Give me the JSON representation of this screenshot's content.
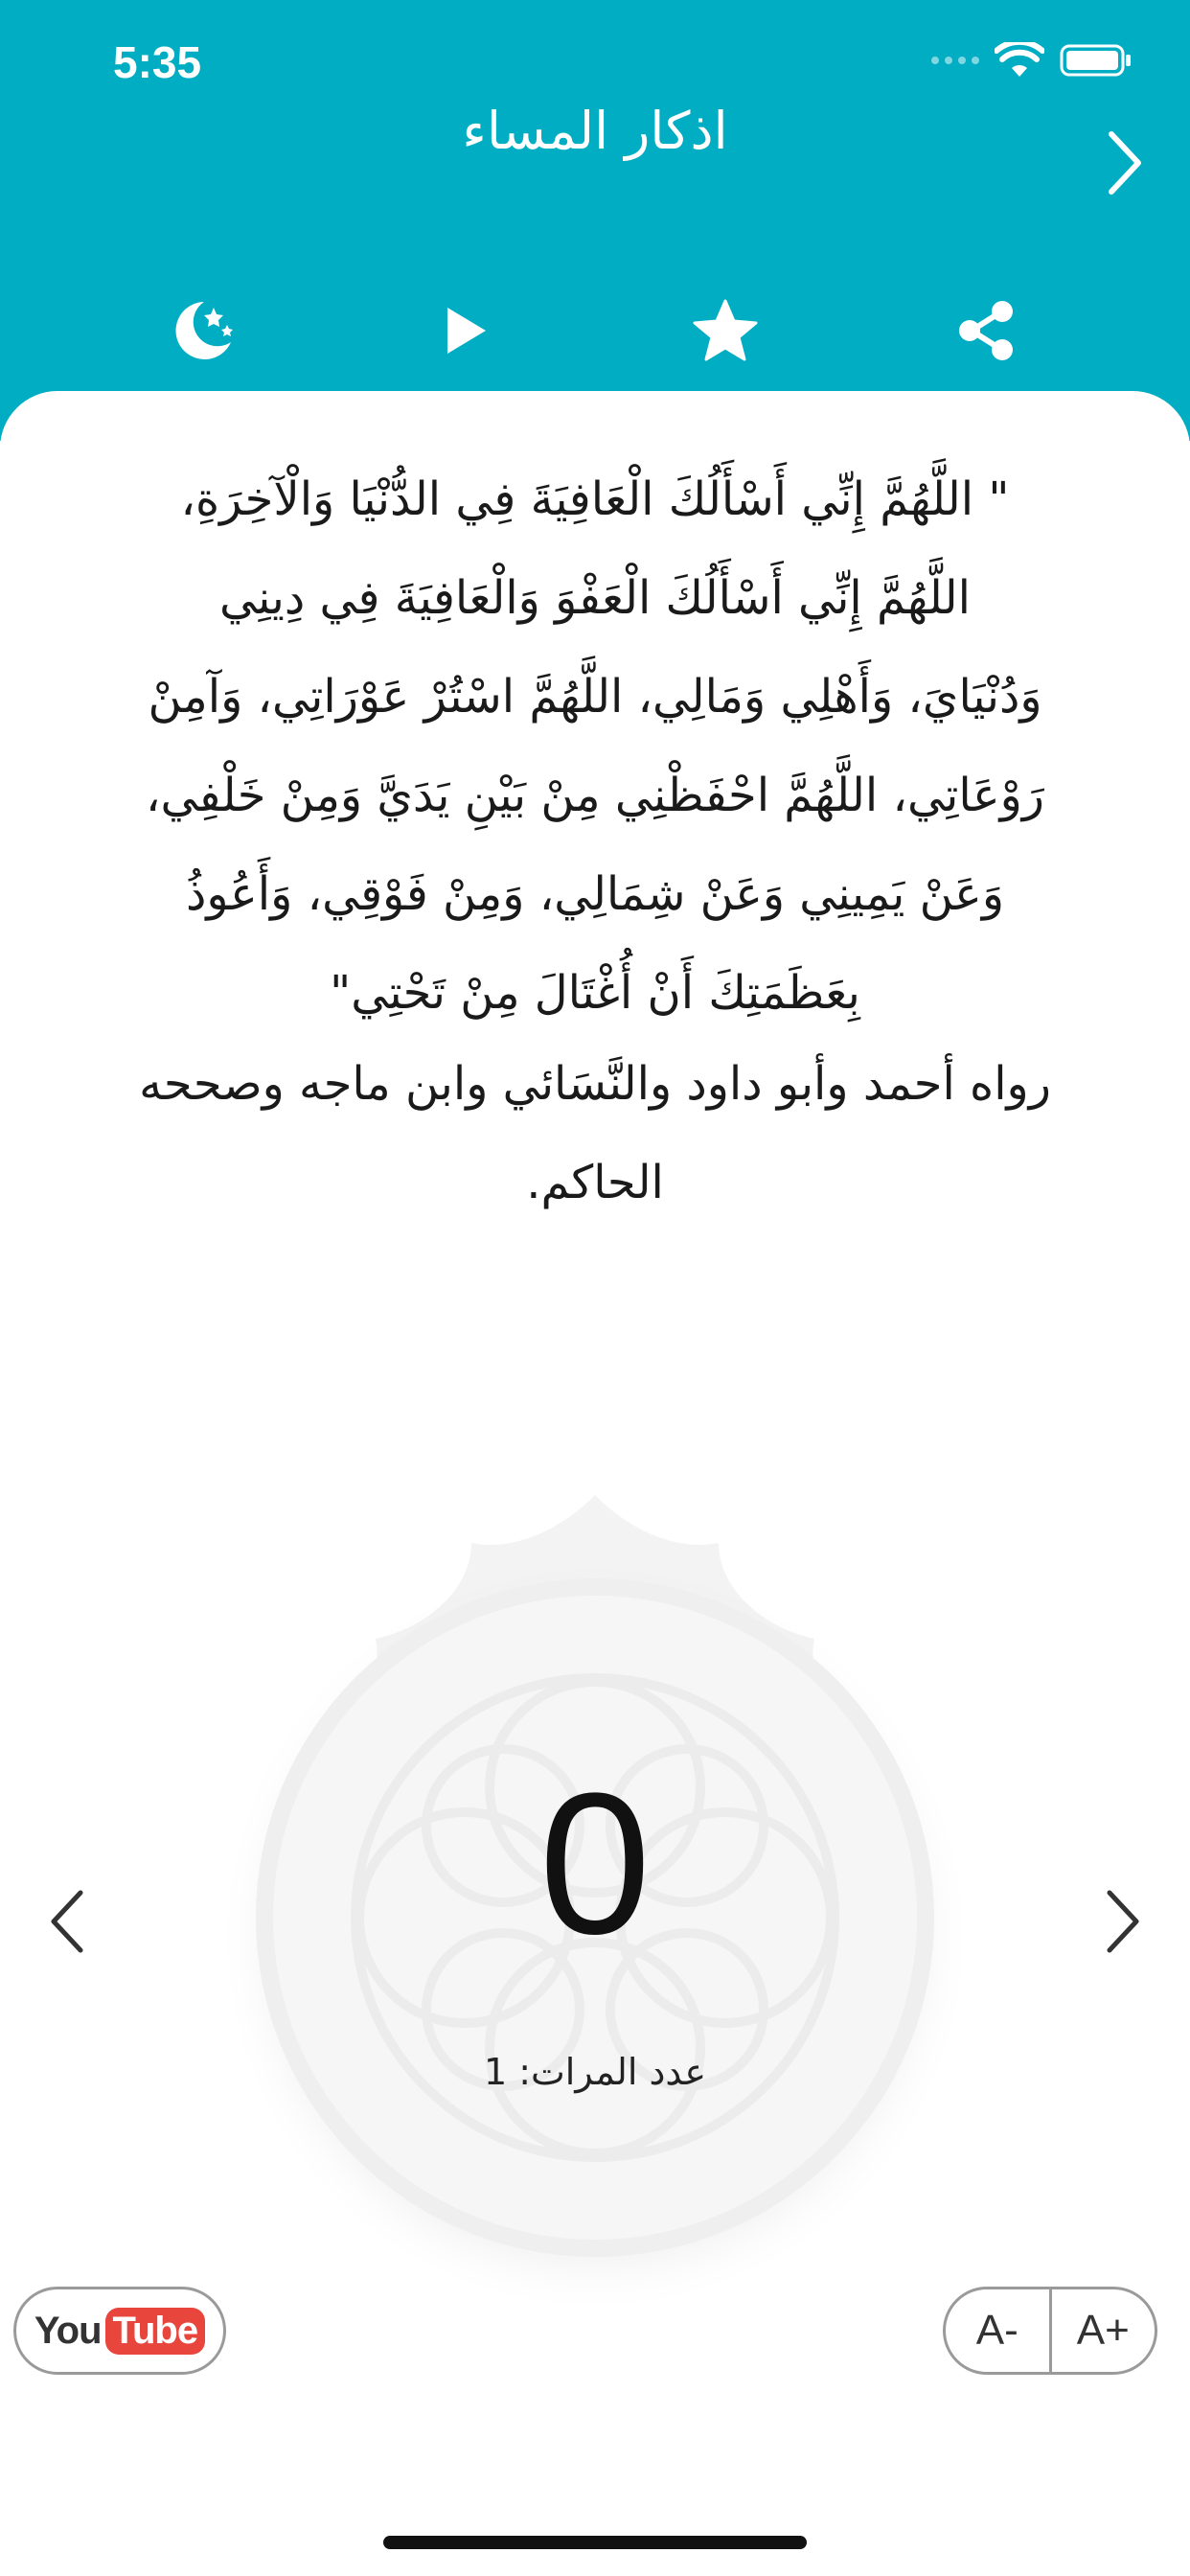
{
  "status_bar": {
    "time": "5:35"
  },
  "header": {
    "title": "اذكار المساء",
    "back_icon": "chevron-right-icon",
    "bg_color": "#01adc3"
  },
  "toolbar": {
    "items": [
      {
        "icon": "moon-stars-icon"
      },
      {
        "icon": "play-icon"
      },
      {
        "icon": "star-icon"
      },
      {
        "icon": "share-icon"
      }
    ]
  },
  "dhikr": {
    "text": "\" اللَّهُمَّ إِنِّي أَسْأَلُكَ الْعَافِيَةَ فِي الدُّنْيَا وَالْآخِرَةِ،\nاللَّهُمَّ إِنِّي أَسْأَلُكَ الْعَفْوَ وَالْعَافِيَةَ فِي دِينِي\nوَدُنْيَايَ، وَأَهْلِي وَمَالِي، اللَّهُمَّ اسْتُرْ عَوْرَاتِي، وَآمِنْ\nرَوْعَاتِي، اللَّهُمَّ احْفَظْنِي مِنْ بَيْنِ يَدَيَّ وَمِنْ خَلْفِي،\nوَعَنْ يَمِينِي وَعَنْ شِمَالِي، وَمِنْ فَوْقِي، وَأَعُوذُ\nبِعَظَمَتِكَ أَنْ أُغْتَالَ مِنْ تَحْتِي\"",
    "narration": "رواه أحمد وأبو داود والنَّسَائي وابن ماجه وصححه\nالحاكم."
  },
  "counter": {
    "value": "0",
    "target_label": "عدد المرات: 1"
  },
  "footer": {
    "youtube_you": "You",
    "youtube_tube": "Tube",
    "font_decrease": "A-",
    "font_increase": "A+"
  }
}
